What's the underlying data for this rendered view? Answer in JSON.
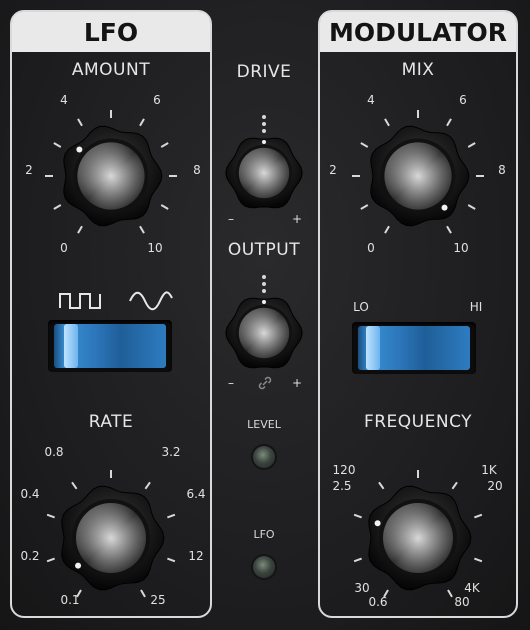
{
  "lfo": {
    "title": "LFO",
    "amount": {
      "label": "AMOUNT",
      "ticks": [
        "0",
        "2",
        "4",
        "6",
        "8",
        "10"
      ]
    },
    "rate": {
      "label": "RATE",
      "ticks": [
        "0.1",
        "0.2",
        "0.4",
        "0.8",
        "3.2",
        "6.4",
        "12",
        "25"
      ]
    },
    "waveform": {
      "options": [
        "square-wave-icon",
        "sine-wave-icon"
      ],
      "selected": "square-wave-icon"
    }
  },
  "center": {
    "drive": {
      "label": "DRIVE",
      "minus": "–",
      "plus": "+"
    },
    "output": {
      "label": "OUTPUT",
      "minus": "–",
      "plus": "+"
    },
    "level_led": {
      "label": "LEVEL"
    },
    "lfo_led": {
      "label": "LFO"
    }
  },
  "modulator": {
    "title": "MODULATOR",
    "mix": {
      "label": "MIX",
      "ticks": [
        "0",
        "2",
        "4",
        "6",
        "8",
        "10"
      ]
    },
    "range_switch": {
      "lo": "LO",
      "hi": "HI",
      "selected": "LO"
    },
    "frequency": {
      "label": "FREQUENCY",
      "ticks": {
        "t120": "120",
        "t25": "2.5",
        "t30": "30",
        "t06": "0.6",
        "t1k": "1K",
        "t20": "20",
        "t4k": "4K",
        "t80": "80"
      }
    }
  },
  "colors": {
    "accent": "#2f82c8",
    "panel_border": "#d9d9d9",
    "title_bg": "#e9e9e9"
  }
}
